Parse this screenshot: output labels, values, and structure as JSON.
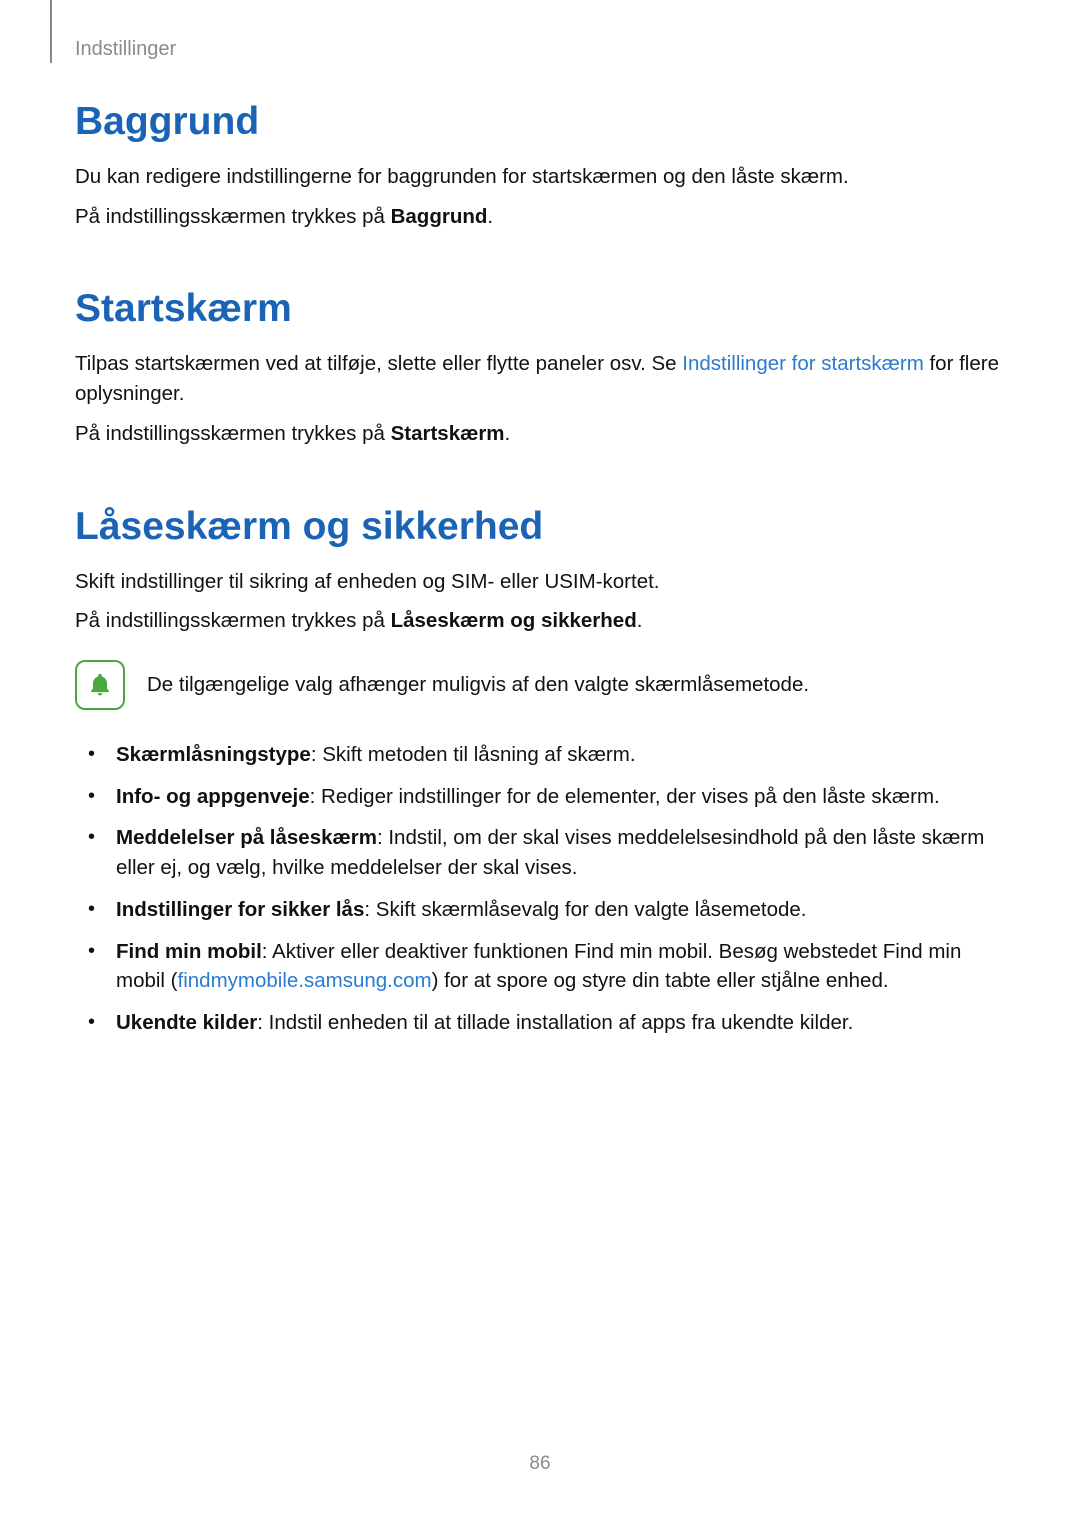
{
  "header": {
    "breadcrumb": "Indstillinger"
  },
  "sections": {
    "baggrund": {
      "title": "Baggrund",
      "p1": "Du kan redigere indstillingerne for baggrunden for startskærmen og den låste skærm.",
      "p2a": "På indstillingsskærmen trykkes på ",
      "p2b": "Baggrund",
      "p2c": "."
    },
    "startskaerm": {
      "title": "Startskærm",
      "p1a": "Tilpas startskærmen ved at tilføje, slette eller flytte paneler osv. Se ",
      "p1_link": "Indstillinger for startskærm",
      "p1b": " for flere oplysninger.",
      "p2a": "På indstillingsskærmen trykkes på ",
      "p2b": "Startskærm",
      "p2c": "."
    },
    "laaseskaerm": {
      "title": "Låseskærm og sikkerhed",
      "p1": "Skift indstillinger til sikring af enheden og SIM- eller USIM-kortet.",
      "p2a": "På indstillingsskærmen trykkes på ",
      "p2b": "Låseskærm og sikkerhed",
      "p2c": ".",
      "note": "De tilgængelige valg afhænger muligvis af den valgte skærmlåsemetode.",
      "bullets": [
        {
          "bold": "Skærmlåsningstype",
          "rest": ": Skift metoden til låsning af skærm."
        },
        {
          "bold": "Info- og appgenveje",
          "rest": ": Rediger indstillinger for de elementer, der vises på den låste skærm."
        },
        {
          "bold": "Meddelelser på låseskærm",
          "rest": ": Indstil, om der skal vises meddelelsesindhold på den låste skærm eller ej, og vælg, hvilke meddelelser der skal vises."
        },
        {
          "bold": "Indstillinger for sikker lås",
          "rest": ": Skift skærmlåsevalg for den valgte låsemetode."
        },
        {
          "bold": "Find min mobil",
          "rest_a": ": Aktiver eller deaktiver funktionen Find min mobil. Besøg webstedet Find min mobil (",
          "link": "findmymobile.samsung.com",
          "rest_b": ") for at spore og styre din tabte eller stjålne enhed."
        },
        {
          "bold": "Ukendte kilder",
          "rest": ": Indstil enheden til at tillade installation af apps fra ukendte kilder."
        }
      ]
    }
  },
  "page_number": "86"
}
